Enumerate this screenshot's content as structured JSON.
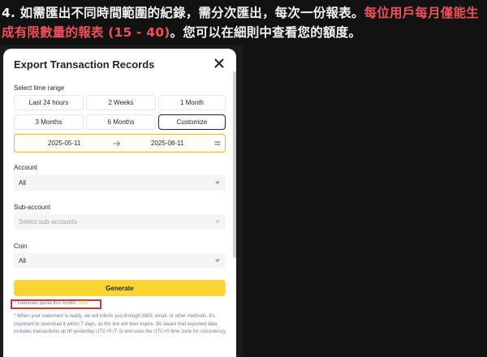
{
  "caption": {
    "prefix": "4. 如需匯出不同時間範圍的紀錄，需分次匯出，每次一份報表。",
    "highlight": "每位用戶每月僅能生成有限數量的報表 (15 - 40)",
    "suffix": "。您可以在細則中查看您的額度。"
  },
  "modal": {
    "title": "Export Transaction Records",
    "time_range_label": "Select time range",
    "ranges": [
      "Last 24 hours",
      "2 Weeks",
      "1 Month",
      "3 Months",
      "6 Months",
      "Customize"
    ],
    "selected_range": "Customize",
    "date_from": "2025-05-11",
    "date_to": "2025-08-11",
    "account_label": "Account",
    "account_value": "All",
    "subaccount_label": "Sub-account",
    "subaccount_placeholder": "Select sub-accounts",
    "coin_label": "Coin",
    "coin_value": "All",
    "generate_label": "Generate",
    "quota_text": "* Generate quota this month:",
    "quota_value": "1/15",
    "note": "* When your statement is ready, we will inform you through SMS, email, or other methods. It's important to download it within 7 days, as the link will then expire. Be aware that exported data includes transactions up till yesterday UTC+0 (T-1) and uses the UTC+0 time zone for consistency."
  },
  "colors": {
    "accent_yellow": "#fcd535",
    "highlight_red": "#f0505a",
    "annotation_red": "#d83434"
  }
}
